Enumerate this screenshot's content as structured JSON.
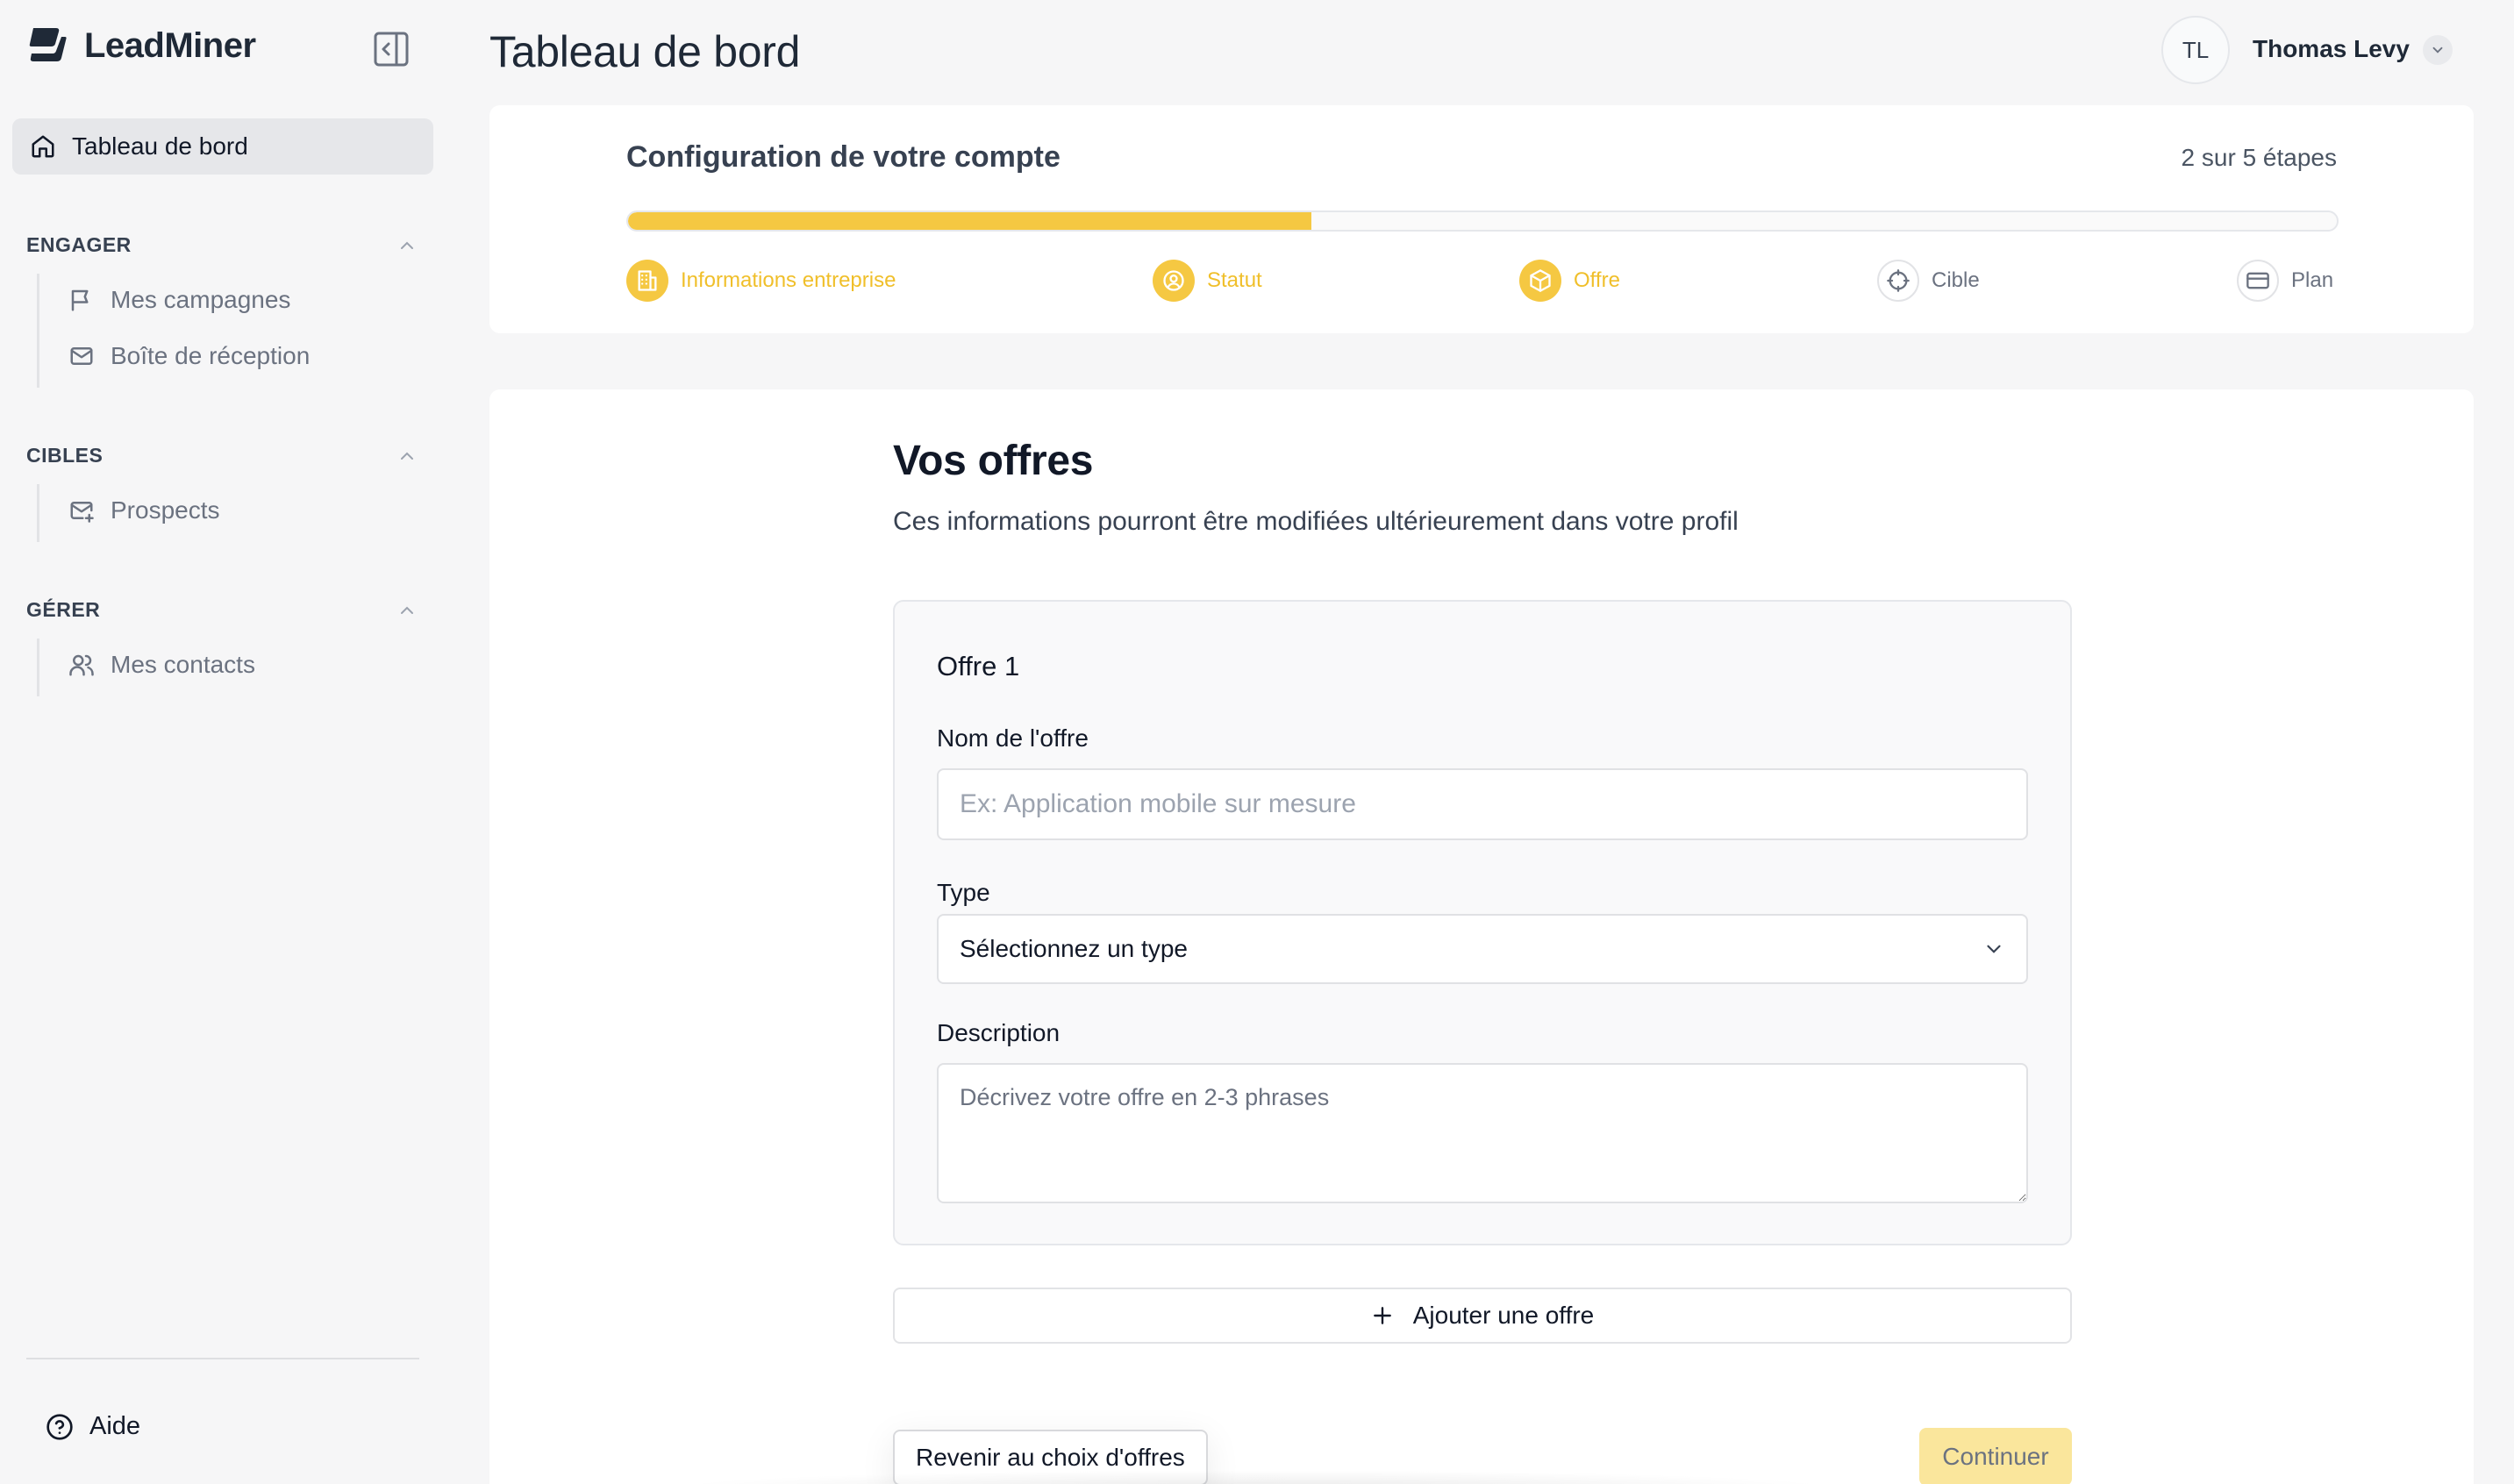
{
  "app": {
    "name": "LeadMiner"
  },
  "sidebar": {
    "active_item": {
      "label": "Tableau de bord",
      "icon": "home-icon"
    },
    "sections": [
      {
        "title": "ENGAGER",
        "items": [
          {
            "label": "Mes campagnes",
            "icon": "flag-icon"
          },
          {
            "label": "Boîte de réception",
            "icon": "mail-icon"
          }
        ]
      },
      {
        "title": "CIBLES",
        "items": [
          {
            "label": "Prospects",
            "icon": "mail-plus-icon"
          }
        ]
      },
      {
        "title": "GÉRER",
        "items": [
          {
            "label": "Mes contacts",
            "icon": "users-icon"
          }
        ]
      }
    ],
    "help_label": "Aide"
  },
  "header": {
    "title": "Tableau de bord",
    "user": {
      "initials": "TL",
      "name": "Thomas Levy"
    }
  },
  "setup": {
    "title": "Configuration de votre compte",
    "steps_count": "2 sur 5 étapes",
    "progress": 0.4,
    "accent_color": "#f5c842",
    "steps": [
      {
        "label": "Informations entreprise",
        "status": "done",
        "icon": "building-icon"
      },
      {
        "label": "Statut",
        "status": "done",
        "icon": "user-circle-icon"
      },
      {
        "label": "Offre",
        "status": "done",
        "icon": "box-icon"
      },
      {
        "label": "Cible",
        "status": "todo",
        "icon": "target-icon"
      },
      {
        "label": "Plan",
        "status": "todo",
        "icon": "credit-card-icon"
      }
    ]
  },
  "offers": {
    "title": "Vos offres",
    "subtitle": "Ces informations pourront être modifiées ultérieurement dans votre profil",
    "offer": {
      "heading": "Offre 1",
      "name_label": "Nom de l'offre",
      "name_placeholder": "Ex: Application mobile sur mesure",
      "type_label": "Type",
      "type_value": "Sélectionnez un type",
      "description_label": "Description",
      "description_placeholder": "Décrivez votre offre en 2-3 phrases"
    },
    "add_label": "Ajouter une offre",
    "back_label": "Revenir au choix d'offres",
    "continue_label": "Continuer"
  }
}
